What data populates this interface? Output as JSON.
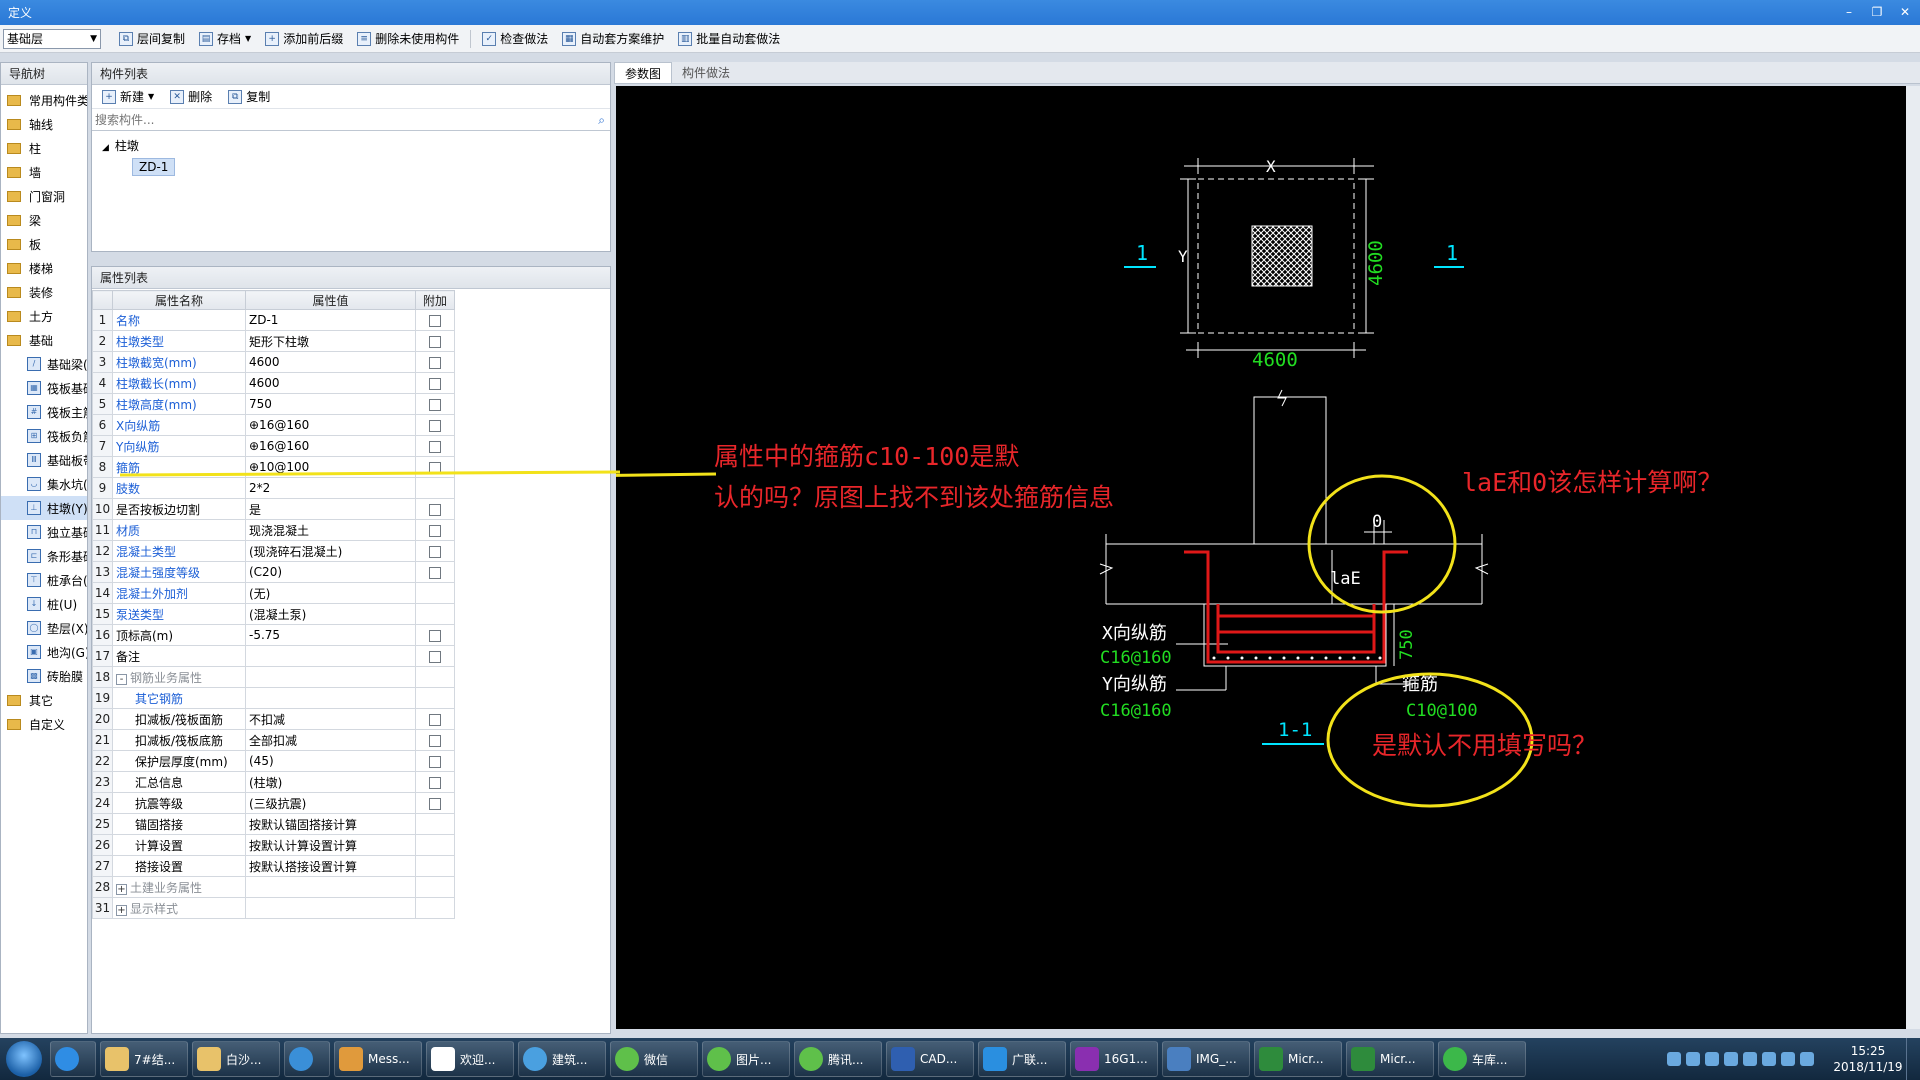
{
  "window": {
    "title": "定义"
  },
  "toolbar": {
    "floor": "基础层",
    "buttons": [
      "层间复制",
      "存档",
      "添加前后缀",
      "删除未使用构件",
      "检查做法",
      "自动套方案维护",
      "批量自动套做法"
    ]
  },
  "nav": {
    "header": "导航树",
    "items": [
      "常用构件类型",
      "轴线",
      "柱",
      "墙",
      "门窗洞",
      "梁",
      "板",
      "楼梯",
      "装修",
      "土方",
      "基础"
    ],
    "sub_items": [
      "基础梁(F)",
      "筏板基础(M)",
      "筏板主筋(R)",
      "筏板负筋(X)",
      "基础板带(W)",
      "集水坑(K)",
      "柱墩(Y)",
      "独立基础(D)",
      "条形基础(T)",
      "桩承台(V)",
      "桩(U)",
      "垫层(X)",
      "地沟(G)",
      "砖胎膜"
    ],
    "after_items": [
      "其它",
      "自定义"
    ]
  },
  "component_list": {
    "header": "构件列表",
    "new_label": "新建",
    "delete_label": "删除",
    "copy_label": "复制",
    "search_placeholder": "搜索构件...",
    "root": "柱墩",
    "child": "ZD-1"
  },
  "property_list": {
    "header": "属性列表",
    "columns": [
      "属性名称",
      "属性值",
      "附加"
    ],
    "rows": [
      {
        "n": "1",
        "name": "名称",
        "value": "ZD-1",
        "blue": true,
        "check": true
      },
      {
        "n": "2",
        "name": "柱墩类型",
        "value": "矩形下柱墩",
        "blue": true,
        "check": true
      },
      {
        "n": "3",
        "name": "柱墩截宽(mm)",
        "value": "4600",
        "blue": true,
        "check": true
      },
      {
        "n": "4",
        "name": "柱墩截长(mm)",
        "value": "4600",
        "blue": true,
        "check": true
      },
      {
        "n": "5",
        "name": "柱墩高度(mm)",
        "value": "750",
        "blue": true,
        "check": true
      },
      {
        "n": "6",
        "name": "X向纵筋",
        "value": "⊕16@160",
        "blue": true,
        "check": true
      },
      {
        "n": "7",
        "name": "Y向纵筋",
        "value": "⊕16@160",
        "blue": true,
        "check": true
      },
      {
        "n": "8",
        "name": "箍筋",
        "value": "⊕10@100",
        "blue": true,
        "check": true
      },
      {
        "n": "9",
        "name": "肢数",
        "value": "2*2",
        "blue": true,
        "check": false
      },
      {
        "n": "10",
        "name": "是否按板边切割",
        "value": "是",
        "blue": false,
        "check": true
      },
      {
        "n": "11",
        "name": "材质",
        "value": "现浇混凝土",
        "blue": true,
        "check": true
      },
      {
        "n": "12",
        "name": "混凝土类型",
        "value": "(现浇碎石混凝土)",
        "blue": true,
        "check": true
      },
      {
        "n": "13",
        "name": "混凝土强度等级",
        "value": "(C20)",
        "blue": true,
        "check": true
      },
      {
        "n": "14",
        "name": "混凝土外加剂",
        "value": "(无)",
        "blue": true,
        "check": false
      },
      {
        "n": "15",
        "name": "泵送类型",
        "value": "(混凝土泵)",
        "blue": true,
        "check": false
      },
      {
        "n": "16",
        "name": "顶标高(m)",
        "value": "-5.75",
        "blue": false,
        "check": true
      },
      {
        "n": "17",
        "name": "备注",
        "value": "",
        "blue": false,
        "check": true
      },
      {
        "n": "18",
        "name": "钢筋业务属性",
        "value": "",
        "group": "-",
        "gray": true,
        "check": false
      },
      {
        "n": "19",
        "name": "其它钢筋",
        "value": "",
        "indent": true,
        "blue": true,
        "check": false
      },
      {
        "n": "20",
        "name": "扣减板/筏板面筋",
        "value": "不扣减",
        "indent": true,
        "check": true
      },
      {
        "n": "21",
        "name": "扣减板/筏板底筋",
        "value": "全部扣减",
        "indent": true,
        "check": true
      },
      {
        "n": "22",
        "name": "保护层厚度(mm)",
        "value": "(45)",
        "indent": true,
        "check": true
      },
      {
        "n": "23",
        "name": "汇总信息",
        "value": "(柱墩)",
        "indent": true,
        "check": true
      },
      {
        "n": "24",
        "name": "抗震等级",
        "value": "(三级抗震)",
        "indent": true,
        "check": true
      },
      {
        "n": "25",
        "name": "锚固搭接",
        "value": "按默认锚固搭接计算",
        "indent": true,
        "check": false
      },
      {
        "n": "26",
        "name": "计算设置",
        "value": "按默认计算设置计算",
        "indent": true,
        "check": false
      },
      {
        "n": "27",
        "name": "搭接设置",
        "value": "按默认搭接设置计算",
        "indent": true,
        "check": false
      },
      {
        "n": "28",
        "name": "土建业务属性",
        "value": "",
        "group": "+",
        "gray": true,
        "check": false
      },
      {
        "n": "31",
        "name": "显示样式",
        "value": "",
        "group": "+",
        "gray": true,
        "check": false
      }
    ]
  },
  "drawing": {
    "tabs": [
      "参数图",
      "构件做法"
    ],
    "labels": {
      "x": "X",
      "y": "Y",
      "dim_width": "4600",
      "dim_height": "4600",
      "section_mark": "1",
      "zero": "0",
      "lae": "laE",
      "depth": "750",
      "x_bar_label": "X向纵筋",
      "x_bar_value": "C16@160",
      "y_bar_label": "Y向纵筋",
      "y_bar_value": "C16@160",
      "stirrup_label": "箍筋",
      "stirrup_value": "C10@100",
      "section_title": "1-1"
    },
    "annotations": {
      "stirrup_q1": "属性中的箍筋c10-100是默",
      "stirrup_q2": "认的吗？原图上找不到该处箍筋信息",
      "lae_q": "laE和0该怎样计算啊？",
      "default_q": "是默认不用填写吗？"
    },
    "colors": {
      "annotation": "#e8262a",
      "circle": "#f2e21a",
      "cyan": "#00e5ff",
      "green": "#22dd22",
      "rebar": "#e01818"
    }
  },
  "taskbar": {
    "items": [
      "7#结...",
      "白沙...",
      "Mess...",
      "欢迎...",
      "建筑...",
      "微信",
      "图片...",
      "腾讯...",
      "CAD...",
      "广联...",
      "16G1...",
      "IMG_...",
      "Micr...",
      "Micr...",
      "车库..."
    ],
    "time": "15:25",
    "date": "2018/11/19"
  }
}
